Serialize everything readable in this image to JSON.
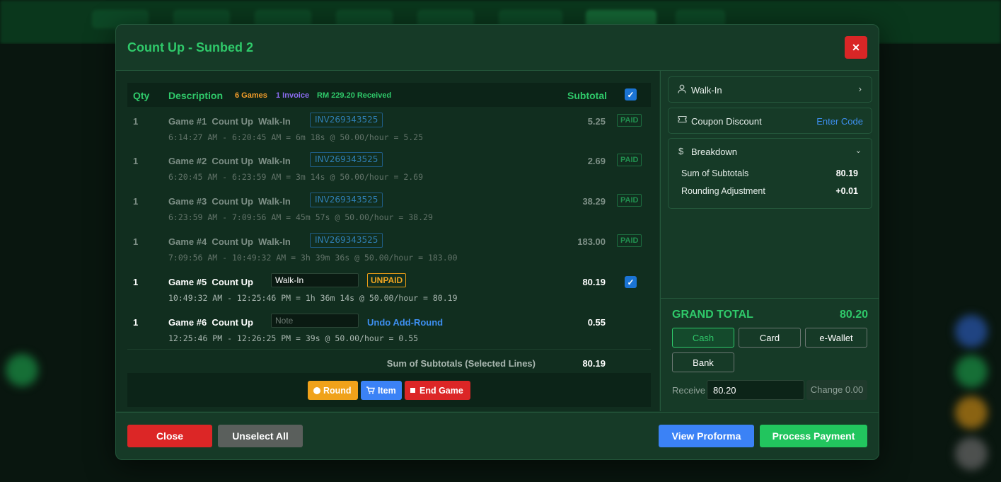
{
  "modal": {
    "title": "Count Up - Sunbed 2",
    "close_icon": "✕"
  },
  "table": {
    "headers": {
      "qty": "Qty",
      "description": "Description",
      "games_badge": "6 Games",
      "invoice_badge": "1 Invoice",
      "received_badge": "RM 229.20 Received",
      "subtotal": "Subtotal"
    },
    "rows": [
      {
        "qty": "1",
        "name": "Game #1  Count Up  Walk-In",
        "invoice": "INV269343525",
        "detail": "6:14:27 AM - 6:20:45 AM = 6m 18s @ 50.00/hour = 5.25",
        "subtotal": "5.25",
        "status": "PAID"
      },
      {
        "qty": "1",
        "name": "Game #2  Count Up  Walk-In",
        "invoice": "INV269343525",
        "detail": "6:20:45 AM - 6:23:59 AM = 3m 14s @ 50.00/hour = 2.69",
        "subtotal": "2.69",
        "status": "PAID"
      },
      {
        "qty": "1",
        "name": "Game #3  Count Up  Walk-In",
        "invoice": "INV269343525",
        "detail": "6:23:59 AM - 7:09:56 AM = 45m 57s @ 50.00/hour = 38.29",
        "subtotal": "38.29",
        "status": "PAID"
      },
      {
        "qty": "1",
        "name": "Game #4  Count Up  Walk-In",
        "invoice": "INV269343525",
        "detail": "7:09:56 AM - 10:49:32 AM = 3h 39m 36s @ 50.00/hour = 183.00",
        "subtotal": "183.00",
        "status": "PAID"
      },
      {
        "qty": "1",
        "name": "Game #5  Count Up",
        "input_value": "Walk-In",
        "status": "UNPAID",
        "detail": "10:49:32 AM - 12:25:46 PM = 1h 36m 14s @ 50.00/hour = 80.19",
        "subtotal": "80.19"
      },
      {
        "qty": "1",
        "name": "Game #6  Count Up",
        "input_placeholder": "Note",
        "undo_label": "Undo Add-Round",
        "detail": "12:25:46 PM - 12:26:25 PM = 39s @ 50.00/hour = 0.55",
        "subtotal": "0.55"
      }
    ],
    "sum_label": "Sum of Subtotals (Selected Lines)",
    "sum_value": "80.19"
  },
  "actions": {
    "round": "Round",
    "item": "Item",
    "end_game": "End Game"
  },
  "right": {
    "customer": "Walk-In",
    "coupon_label": "Coupon Discount",
    "coupon_action": "Enter Code",
    "breakdown_label": "Breakdown",
    "breakdown": [
      {
        "label": "Sum of Subtotals",
        "value": "80.19"
      },
      {
        "label": "Rounding Adjustment",
        "value": "+0.01"
      }
    ],
    "grand_total_label": "GRAND TOTAL",
    "grand_total_value": "80.20",
    "payment_methods": [
      "Cash",
      "Card",
      "e-Wallet",
      "Bank"
    ],
    "selected_method": "Cash",
    "receive_label": "Receive",
    "receive_value": "80.20",
    "change_text": "Change 0.00"
  },
  "footer": {
    "close": "Close",
    "unselect_all": "Unselect All",
    "view_proforma": "View Proforma",
    "process_payment": "Process Payment"
  },
  "colors": {
    "accent_green": "#2fc96a",
    "danger": "#dc2626",
    "primary": "#3b82f6",
    "warning": "#f0a21a"
  }
}
